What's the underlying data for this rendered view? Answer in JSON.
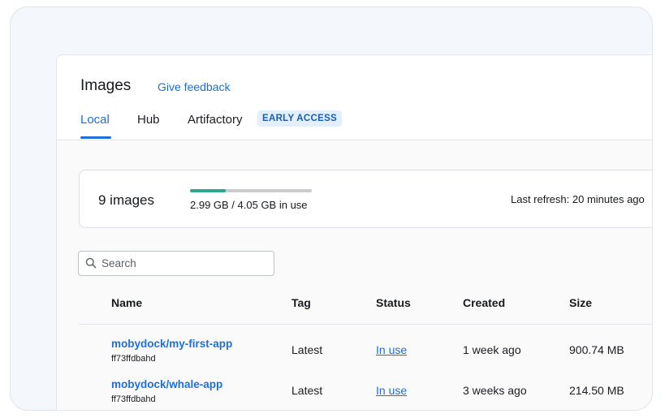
{
  "header": {
    "title": "Images",
    "feedback_link": "Give feedback",
    "tabs": [
      {
        "label": "Local",
        "active": true
      },
      {
        "label": "Hub",
        "active": false
      },
      {
        "label": "Artifactory",
        "active": false
      }
    ],
    "badge": "EARLY ACCESS"
  },
  "summary": {
    "image_count": "9 images",
    "usage_text": "2.99 GB / 4.05 GB in use",
    "usage_fraction": 0.295,
    "last_refresh": "Last refresh: 20 minutes ago"
  },
  "search": {
    "placeholder": "Search",
    "value": ""
  },
  "table": {
    "columns": [
      "Name",
      "Tag",
      "Status",
      "Created",
      "Size"
    ],
    "rows": [
      {
        "name": "mobydock/my-first-app",
        "id": "ff73ffdbahd",
        "tag": "Latest",
        "status": "In use",
        "created": "1 week ago",
        "size": "900.74 MB"
      },
      {
        "name": "mobydock/whale-app",
        "id": "ff73ffdbahd",
        "tag": "Latest",
        "status": "In use",
        "created": "3 weeks ago",
        "size": "214.50 MB"
      }
    ]
  },
  "colors": {
    "accent": "#1f6fd6",
    "progress": "#2fa58e",
    "badge_bg": "#e3effc"
  },
  "icons": {
    "search": "search-icon"
  }
}
